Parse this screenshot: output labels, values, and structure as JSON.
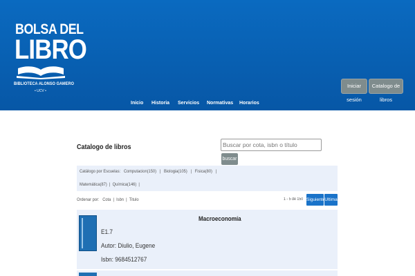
{
  "brand": {
    "logo_top": "BOLSA DEL",
    "logo_main": "LIBRO",
    "logo_sub": "BIBLIOTECA ALONSO GAMERO",
    "logo_year": "• UCV •",
    "header_color": "#0a6ac0"
  },
  "header": {
    "login_label": "Iniciar sesión",
    "catalog_label": "Catalogo de libros"
  },
  "nav": {
    "items": [
      "Inicio",
      "Historia",
      "Servicios",
      "Normativas",
      "Horarios"
    ]
  },
  "catalog": {
    "title": "Catalogo de libros",
    "search_placeholder": "Buscar por cota, isbn o título",
    "search_button": "buscar"
  },
  "filters": {
    "prefix": "Catálogo   por   Escuelas:",
    "schools": [
      {
        "label": "Computacion(150)"
      },
      {
        "label": "Biologia(105)"
      },
      {
        "label": "Fisica(80)"
      },
      {
        "label": "Matemática(87)"
      },
      {
        "label": "Química(146)"
      }
    ]
  },
  "sort": {
    "label": "Ordenar por:",
    "options": [
      "Cota",
      "Isbn",
      "Titulo"
    ]
  },
  "pagination": {
    "range": "1 - 5 de 150",
    "next_label": "Siguiente",
    "last_label": "Ultima"
  },
  "books": [
    {
      "title": "Macroeconomía",
      "cota": "E1.7",
      "author": "Autor: Diulio, Eugene",
      "isbn": "Isbn: 9684512767"
    }
  ]
}
